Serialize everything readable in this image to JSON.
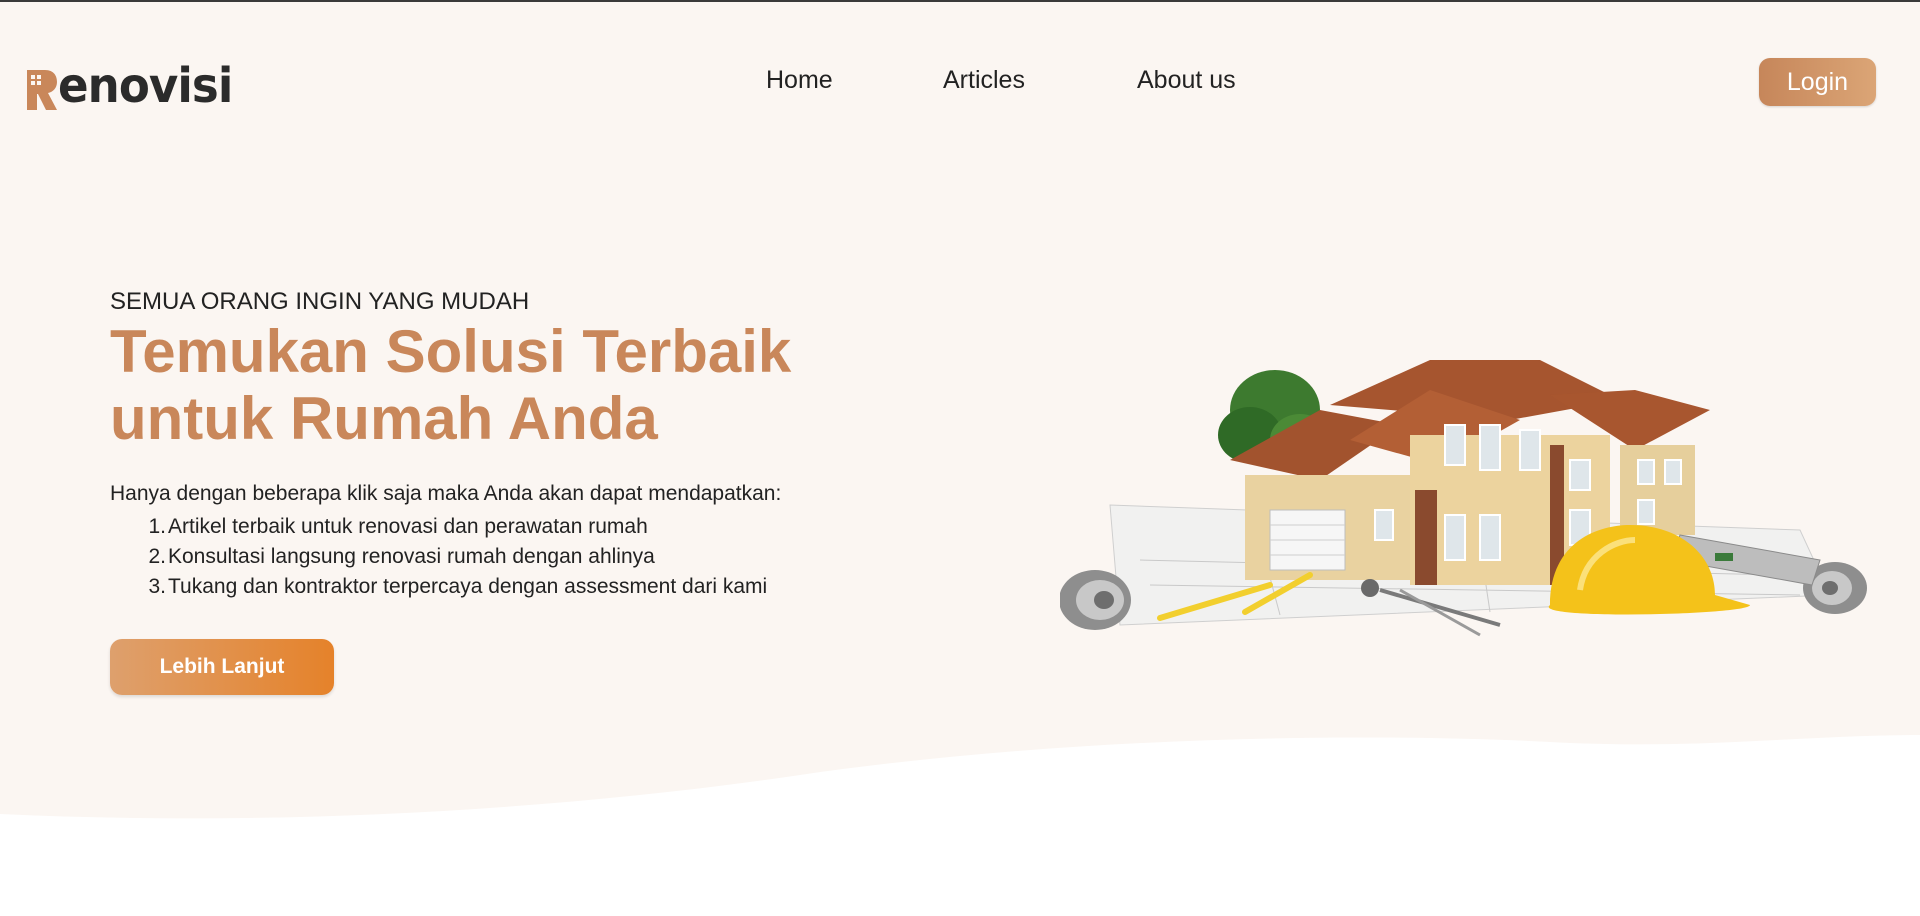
{
  "brand": {
    "name": "enovisi",
    "logo_letter": "R"
  },
  "nav": {
    "home": "Home",
    "articles": "Articles",
    "about": "About us"
  },
  "header": {
    "login_label": "Login"
  },
  "hero": {
    "eyebrow": "SEMUA ORANG INGIN YANG MUDAH",
    "headline_line1": "Temukan Solusi Terbaik",
    "headline_line2": "untuk Rumah Anda",
    "intro": "Hanya dengan beberapa klik saja maka Anda akan dapat mendapatkan:",
    "benefits": [
      {
        "num": "1.",
        "text": "Artikel terbaik untuk renovasi dan perawatan rumah"
      },
      {
        "num": "2.",
        "text": "Konsultasi langsung renovasi rumah dengan ahlinya"
      },
      {
        "num": "3.",
        "text": "Tukang dan kontraktor terpercaya dengan assessment dari kami"
      }
    ],
    "cta_label": "Lebih Lanjut"
  },
  "colors": {
    "hero_background": "#fbf6f2",
    "accent": "#c9875a",
    "button_login": "#d39a6c",
    "button_cta": "#e5822a",
    "text": "#222222"
  },
  "icons": [
    "logo-building-icon",
    "house-illustration"
  ]
}
